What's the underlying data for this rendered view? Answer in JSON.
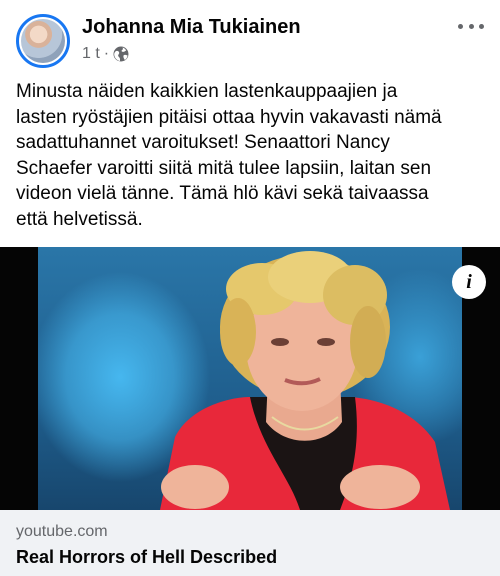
{
  "author": {
    "name": "Johanna Mia Tukiainen",
    "time": "1 t",
    "separator": "·",
    "privacy_icon": "globe-icon"
  },
  "menu_icon": "more-options-icon",
  "post": {
    "lines": [
      "Minusta näiden kaikkien lastenkauppaajien ja",
      "lasten ryöstäjien pitäisi ottaa hyvin vakavasti nämä",
      "sadattuhannet varoitukset! Senaattori Nancy",
      "Schaefer varoitti siitä mitä tulee lapsiin, laitan sen",
      "videon vielä tänne. Tämä hlö kävi sekä taivaassa",
      "että helvetissä."
    ]
  },
  "video": {
    "info_label": "i"
  },
  "link": {
    "domain": "youtube.com",
    "title": "Real Horrors of Hell Described"
  },
  "colors": {
    "accent": "#1877f2",
    "secondary_text": "#65676b",
    "footer_bg": "#f0f2f5",
    "jacket": "#e8283a"
  }
}
